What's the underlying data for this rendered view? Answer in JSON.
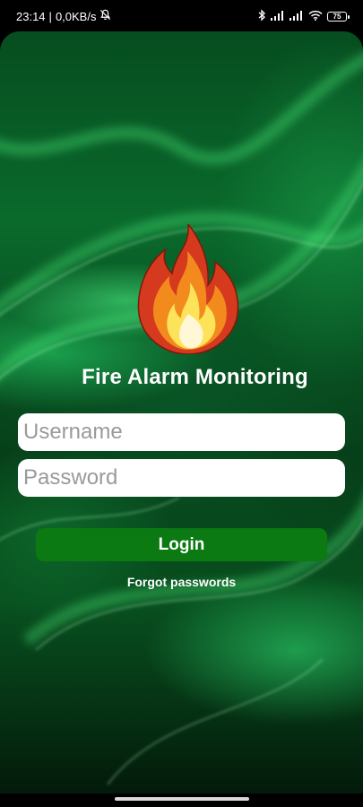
{
  "status_bar": {
    "time": "23:14",
    "separator": "|",
    "net_speed": "0,0KB/s",
    "battery_level": "75",
    "icons": [
      "bell-off-icon",
      "bluetooth-icon",
      "signal-icon",
      "signal-icon",
      "wifi-icon",
      "battery-icon"
    ]
  },
  "app": {
    "title": "Fire Alarm Monitoring",
    "logo_icon": "flame-icon"
  },
  "form": {
    "username_placeholder": "Username",
    "username_value": "",
    "password_placeholder": "Password",
    "password_value": "",
    "login_label": "Login",
    "forgot_label": "Forgot passwords"
  },
  "colors": {
    "accent_button": "#0b7a12",
    "background_green": "#0a6a2c",
    "flame_red": "#d63a1e",
    "flame_orange": "#f28a1d",
    "flame_yellow": "#fde35a"
  }
}
